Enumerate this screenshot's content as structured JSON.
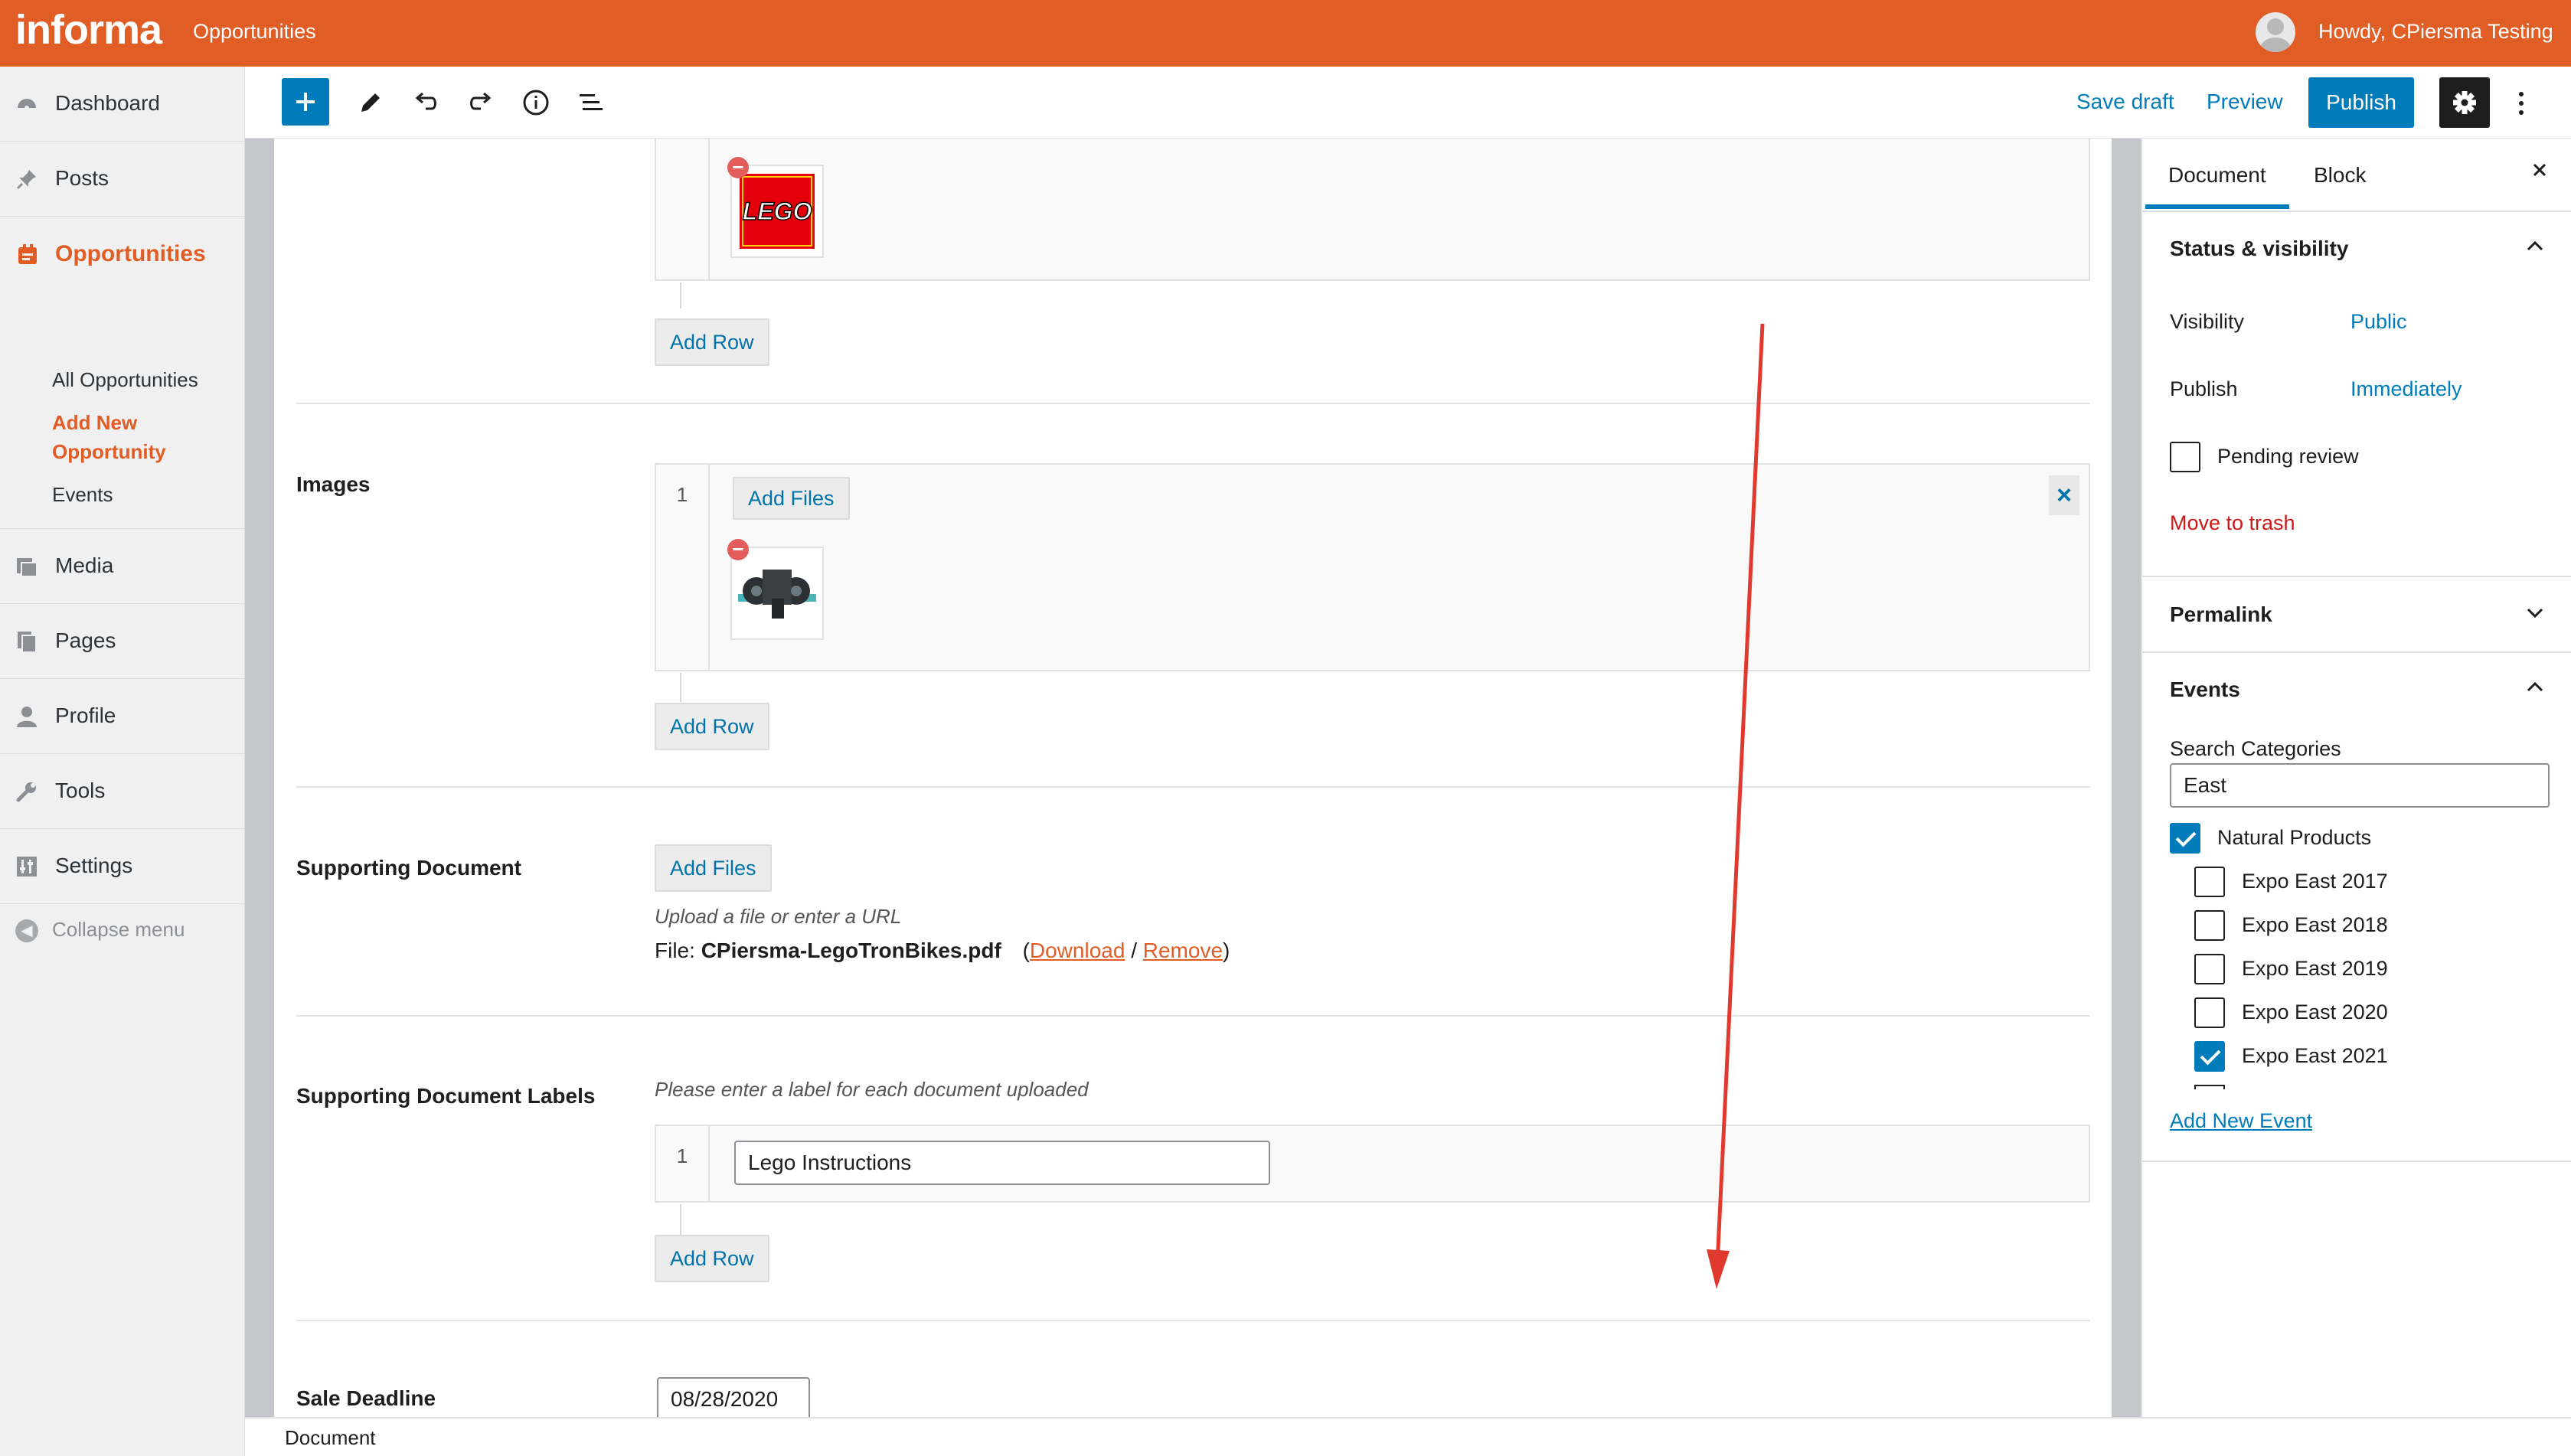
{
  "topbar": {
    "logo": "informa",
    "site_name": "Opportunities",
    "greeting": "Howdy, CPiersma Testing",
    "accent": "#e05d26"
  },
  "sidebar": {
    "items": [
      {
        "label": "Dashboard",
        "icon": "dashboard-icon"
      },
      {
        "label": "Posts",
        "icon": "pin-icon"
      },
      {
        "label": "Opportunities",
        "icon": "opportunities-icon"
      },
      {
        "label": "Media",
        "icon": "media-icon"
      },
      {
        "label": "Pages",
        "icon": "pages-icon"
      },
      {
        "label": "Profile",
        "icon": "user-icon"
      },
      {
        "label": "Tools",
        "icon": "wrench-icon"
      },
      {
        "label": "Settings",
        "icon": "settings-icon"
      }
    ],
    "submenu": [
      "All Opportunities",
      "Add New Opportunity",
      "Events"
    ],
    "submenu_active_line1": "Add New",
    "submenu_active_line2": "Opportunity",
    "collapse": "Collapse menu"
  },
  "toolbar": {
    "save_draft": "Save draft",
    "preview": "Preview",
    "publish": "Publish"
  },
  "editor": {
    "add_row": "Add Row",
    "images": {
      "label": "Images",
      "row_number": "1",
      "add_files": "Add Files"
    },
    "supporting_document": {
      "label": "Supporting Document",
      "add_files": "Add Files",
      "hint": "Upload a file or enter a URL",
      "file_prefix": "File:",
      "file_name": "CPiersma-LegoTronBikes.pdf",
      "download": "Download",
      "remove": "Remove"
    },
    "supporting_document_labels": {
      "label": "Supporting Document Labels",
      "hint": "Please enter a label for each document uploaded",
      "row_number": "1",
      "value": "Lego Instructions"
    },
    "sale_deadline": {
      "label": "Sale Deadline",
      "value": "08/28/2020"
    },
    "logo_text": "LEGO"
  },
  "footer": {
    "breadcrumb": "Document"
  },
  "settings": {
    "tabs": [
      "Document",
      "Block"
    ],
    "status": {
      "title": "Status & visibility",
      "visibility_label": "Visibility",
      "visibility_value": "Public",
      "publish_label": "Publish",
      "publish_value": "Immediately",
      "pending_review": "Pending review",
      "move_to_trash": "Move to trash"
    },
    "permalink": "Permalink",
    "events": {
      "title": "Events",
      "search_label": "Search Categories",
      "search_value": "East",
      "parent": {
        "label": "Natural Products",
        "checked": true
      },
      "children": [
        {
          "label": "Expo East 2017",
          "checked": false
        },
        {
          "label": "Expo East 2018",
          "checked": false
        },
        {
          "label": "Expo East 2019",
          "checked": false
        },
        {
          "label": "Expo East 2020",
          "checked": false
        },
        {
          "label": "Expo East 2021",
          "checked": true
        }
      ],
      "add_new": "Add New Event"
    }
  }
}
